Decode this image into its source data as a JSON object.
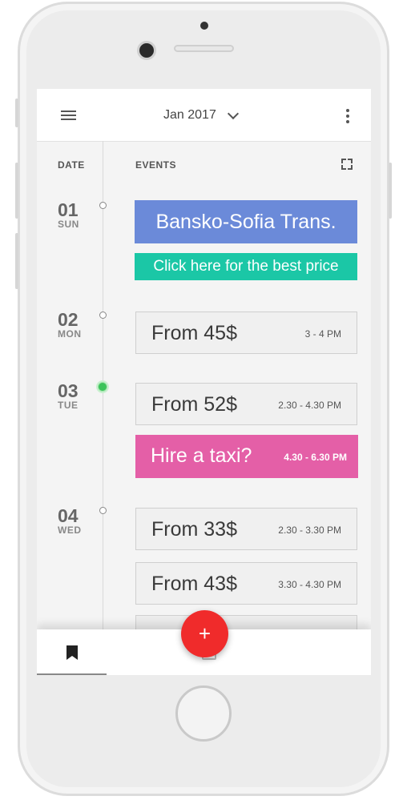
{
  "topbar": {
    "month": "Jan 2017"
  },
  "headers": {
    "date": "DATE",
    "events": "EVENTS"
  },
  "days": [
    {
      "num": "01",
      "name": "SUN"
    },
    {
      "num": "02",
      "name": "MON"
    },
    {
      "num": "03",
      "name": "TUE"
    },
    {
      "num": "04",
      "name": "WED"
    }
  ],
  "events": {
    "banner_title": "Bansko-Sofia Trans.",
    "banner_link": "Click here for the best price",
    "e1": {
      "price": "From 45$",
      "time": "3 - 4 PM"
    },
    "e2": {
      "price": "From 52$",
      "time": "2.30 - 4.30 PM"
    },
    "e3": {
      "price": "Hire a taxi?",
      "time": "4.30 - 6.30 PM"
    },
    "e4": {
      "price": "From 33$",
      "time": "2.30 - 3.30 PM"
    },
    "e5": {
      "price": "From 43$",
      "time": "3.30 - 4.30 PM"
    }
  },
  "fab": {
    "label": "+"
  },
  "icons": {
    "menu": "hamburger-menu-icon",
    "more": "more-vertical-icon",
    "expand": "fullscreen-icon",
    "nav": [
      "bookmark-icon",
      "calendar-icon",
      "grid-icon",
      "heart-icon"
    ]
  },
  "colors": {
    "active_dot": "#3bc35a",
    "fab": "#f02b2b",
    "blue": "#6b8ad9",
    "teal": "#1bc7a6",
    "pink": "#e45fa7"
  }
}
